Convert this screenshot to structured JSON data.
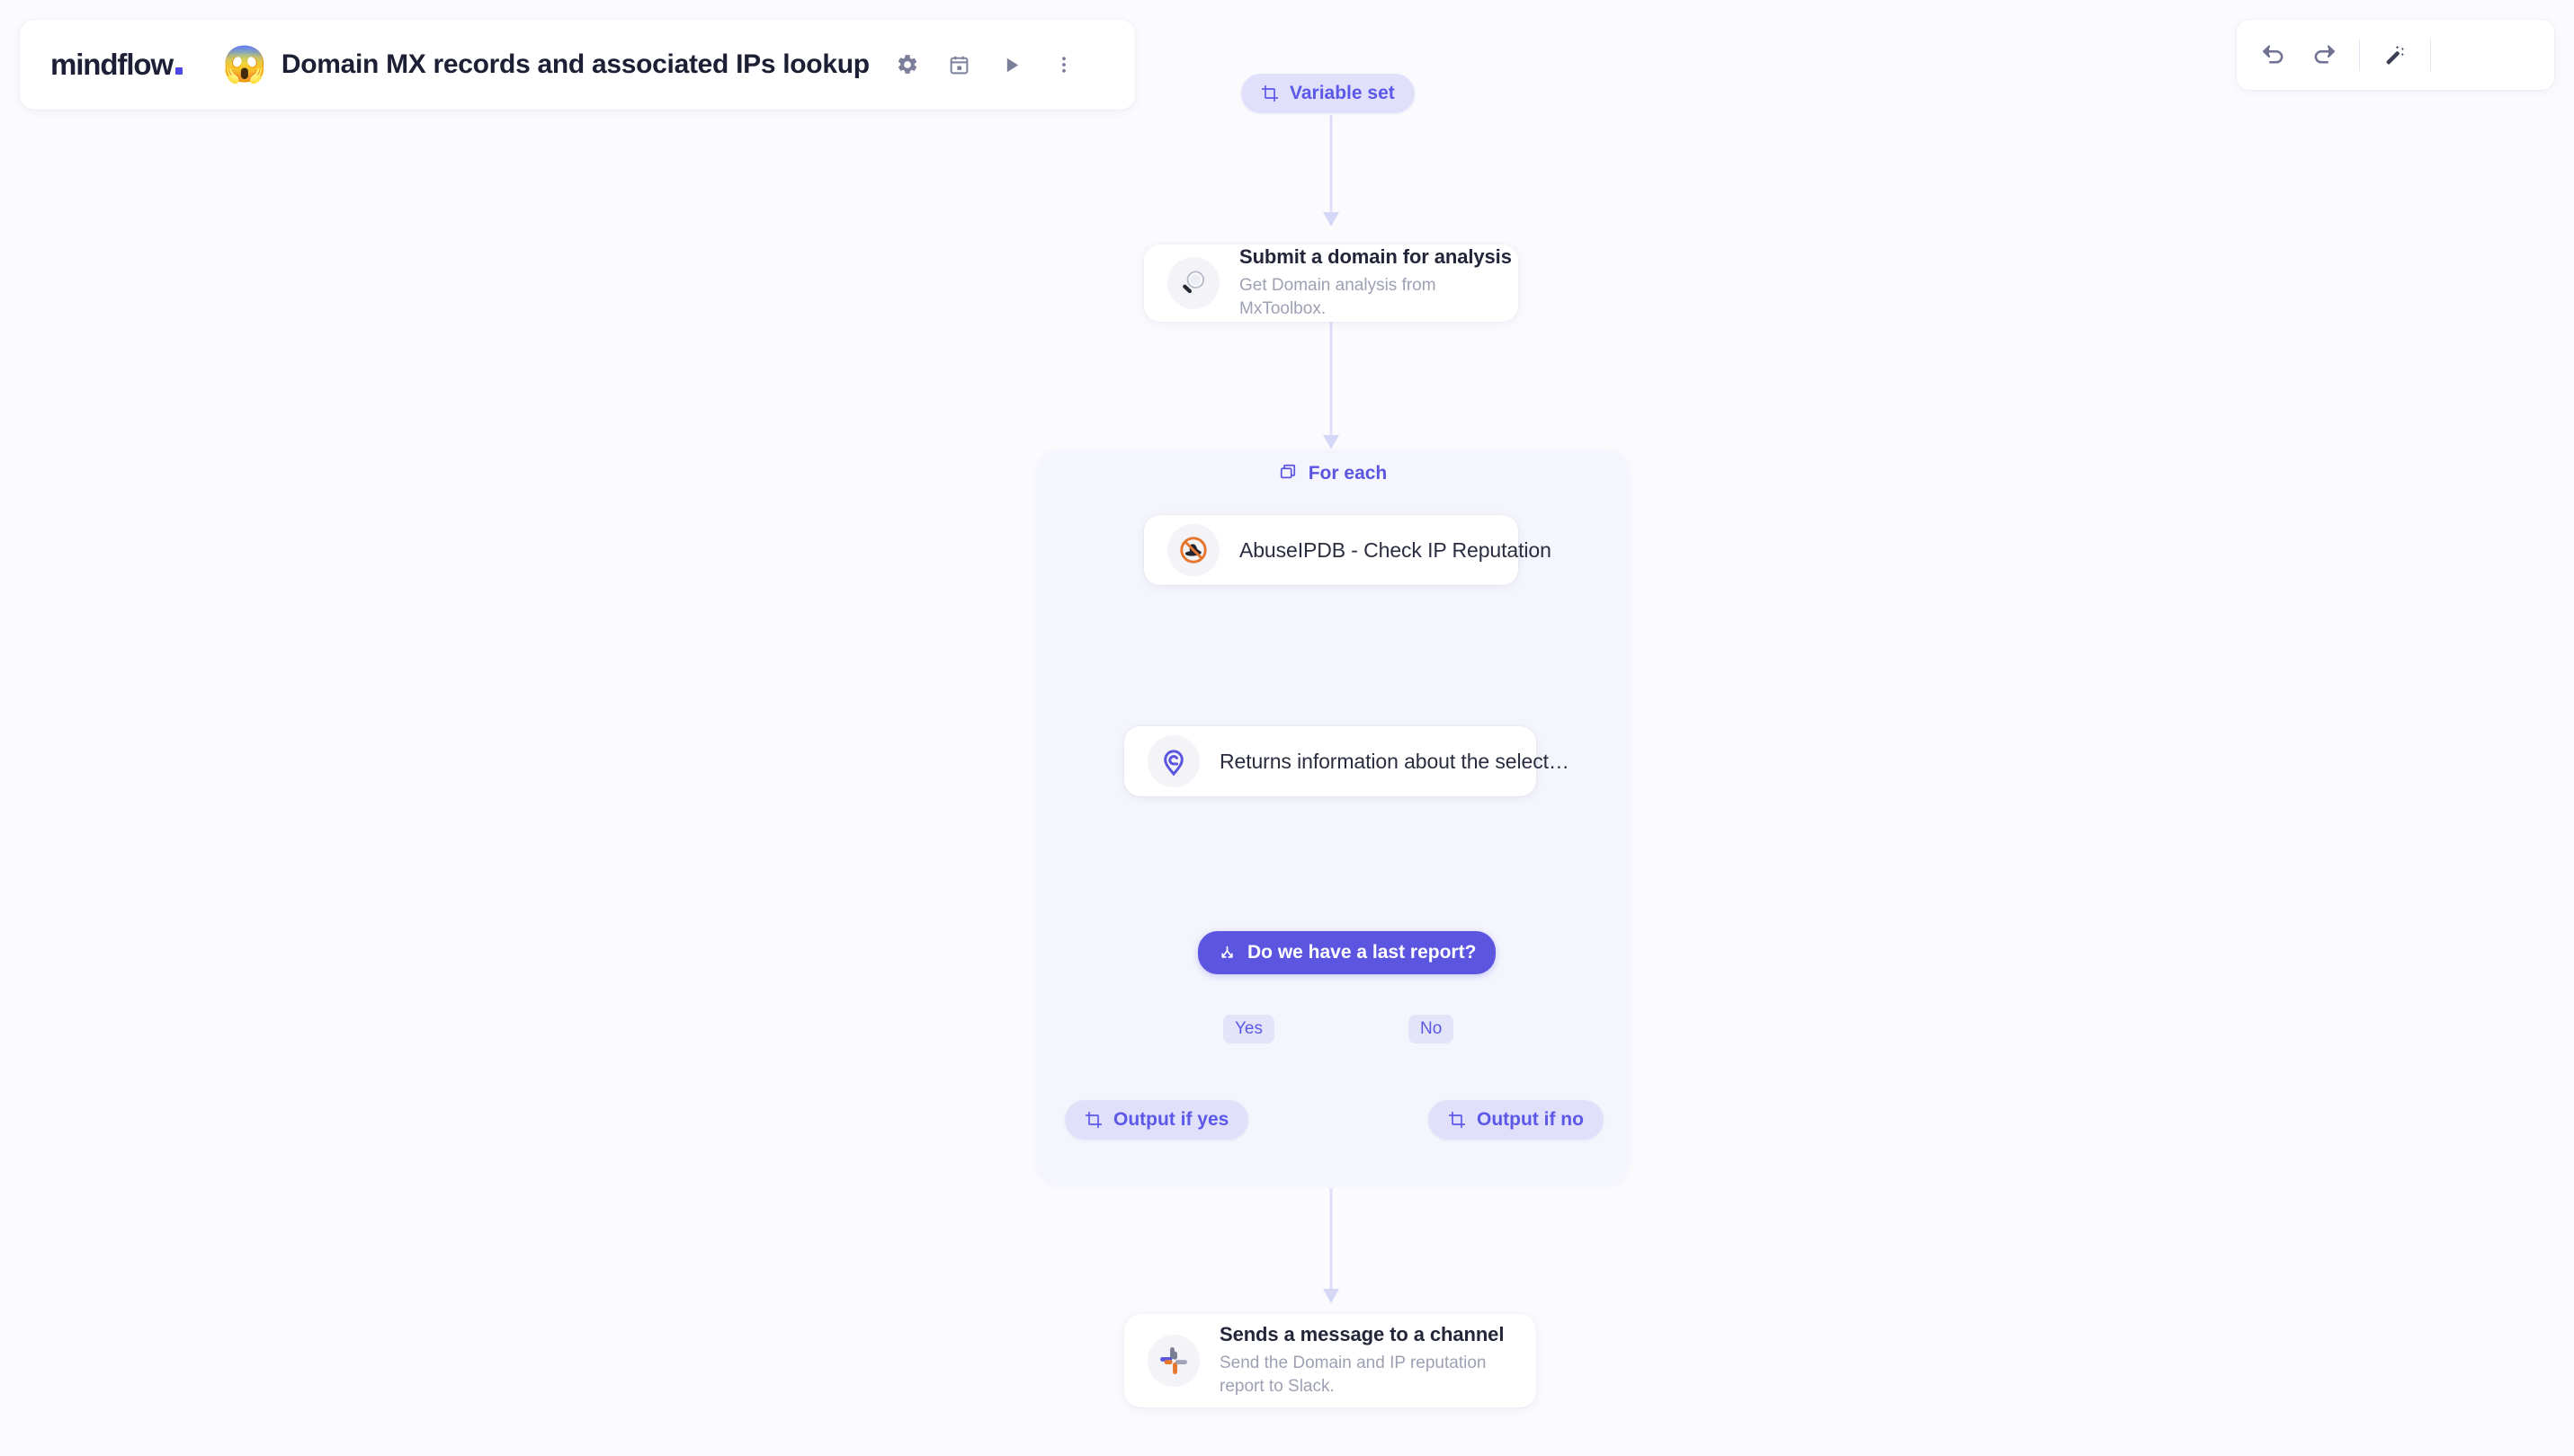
{
  "header": {
    "logo_text": "mindflow",
    "flow_emoji": "😱",
    "flow_title": "Domain MX records and associated IPs lookup",
    "icons": [
      {
        "name": "settings-icon",
        "label": "Settings"
      },
      {
        "name": "schedule-icon",
        "label": "Schedule"
      },
      {
        "name": "run-icon",
        "label": "Run"
      },
      {
        "name": "more-options-icon",
        "label": "More options"
      }
    ]
  },
  "toolbar": {
    "undo_label": "Undo",
    "redo_label": "Redo",
    "magic_label": "Auto layout"
  },
  "flow": {
    "variable_set": {
      "label": "Variable set",
      "icon": "variable-set-icon"
    },
    "submit_domain": {
      "title": "Submit a domain for analysis",
      "subtitle": "Get Domain analysis from MxToolbox.",
      "icon": "mxtoolbox-magnifier-icon"
    },
    "for_each": {
      "label": "For each",
      "icon": "layers-icon"
    },
    "abuseipdb": {
      "title": "AbuseIPDB - Check IP Reputation",
      "icon": "abuseipdb-hat-icon"
    },
    "returns_info": {
      "title": "Returns information about the select…",
      "icon": "location-pin-icon"
    },
    "condition": {
      "label": "Do we have a last report?",
      "icon": "branch-icon"
    },
    "edge_yes": "Yes",
    "edge_no": "No",
    "output_yes": {
      "label": "Output if yes",
      "icon": "variable-set-icon"
    },
    "output_no": {
      "label": "Output if no",
      "icon": "variable-set-icon"
    },
    "slack": {
      "title": "Sends a message to a channel",
      "subtitle": "Send the Domain and IP reputation report to Slack.",
      "icon": "slack-icon"
    }
  },
  "colors": {
    "accent": "#5b55e0",
    "pill_bg": "#e0e0fb",
    "container_bg": "#f5f5fd",
    "canvas_bg": "#fbfbfe",
    "connector": "#dedefb"
  }
}
